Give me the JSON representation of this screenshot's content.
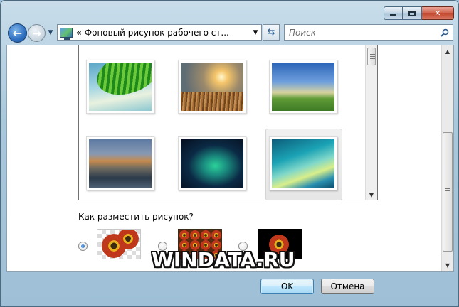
{
  "window": {
    "controls": {
      "minimize": "minimize",
      "maximize": "maximize",
      "close": "close"
    }
  },
  "nav": {
    "back_icon": "back-arrow-icon",
    "forward_icon": "forward-arrow-icon",
    "address_prefix": "«",
    "address_text": "Фоновый рисунок рабочего ст...",
    "search_placeholder": "Поиск"
  },
  "gallery": {
    "items": [
      {
        "name": "palm-leaf-wallpaper"
      },
      {
        "name": "sunset-field-wallpaper"
      },
      {
        "name": "green-hills-wallpaper"
      },
      {
        "name": "rocky-lake-wallpaper"
      },
      {
        "name": "aurora-wallpaper"
      },
      {
        "name": "vista-wallpaper",
        "selected": true
      }
    ]
  },
  "positioning": {
    "label": "Как разместить рисунок?",
    "options": [
      {
        "id": "fit",
        "checked": true
      },
      {
        "id": "tile",
        "checked": false
      },
      {
        "id": "center",
        "checked": false
      }
    ]
  },
  "watermark": "WINDATA.RU",
  "buttons": {
    "ok": "OK",
    "cancel": "Отмена"
  },
  "colors": {
    "accent": "#3c7fb1",
    "window_frame": "#a9c8dc"
  }
}
